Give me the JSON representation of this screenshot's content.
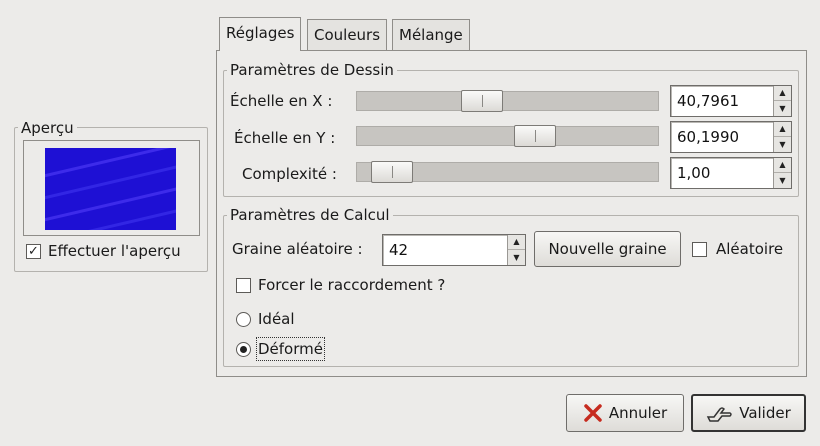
{
  "preview": {
    "title": "Aperçu",
    "checkbox_label": "Effectuer l'aperçu",
    "checked": true
  },
  "tabs": [
    {
      "label": "Réglages",
      "active": true
    },
    {
      "label": "Couleurs",
      "active": false
    },
    {
      "label": "Mélange",
      "active": false
    }
  ],
  "dessin": {
    "title": "Paramètres de Dessin",
    "scale_x": {
      "label": "Échelle en X :",
      "value": "40,7961",
      "fraction": 0.408
    },
    "scale_y": {
      "label": "Échelle en Y :",
      "value": "60,1990",
      "fraction": 0.602
    },
    "complexity": {
      "label": "Complexité :",
      "value": "1,00",
      "fraction": 0.02
    }
  },
  "calcul": {
    "title": "Paramètres de Calcul",
    "seed_label": "Graine aléatoire :",
    "seed_value": "42",
    "new_seed_button": "Nouvelle graine",
    "random_label": "Aléatoire",
    "random_checked": false,
    "force_label": "Forcer le raccordement ?",
    "force_checked": false,
    "ideal_label": "Idéal",
    "deform_label": "Déformé",
    "selected": "Déformé"
  },
  "footer": {
    "cancel_label": "Annuler",
    "ok_label": "Valider"
  },
  "icons": {
    "cancel": "cancel-x-icon",
    "ok": "validate-hand-icon"
  },
  "colors": {
    "preview_blue": "#1e10d4"
  }
}
